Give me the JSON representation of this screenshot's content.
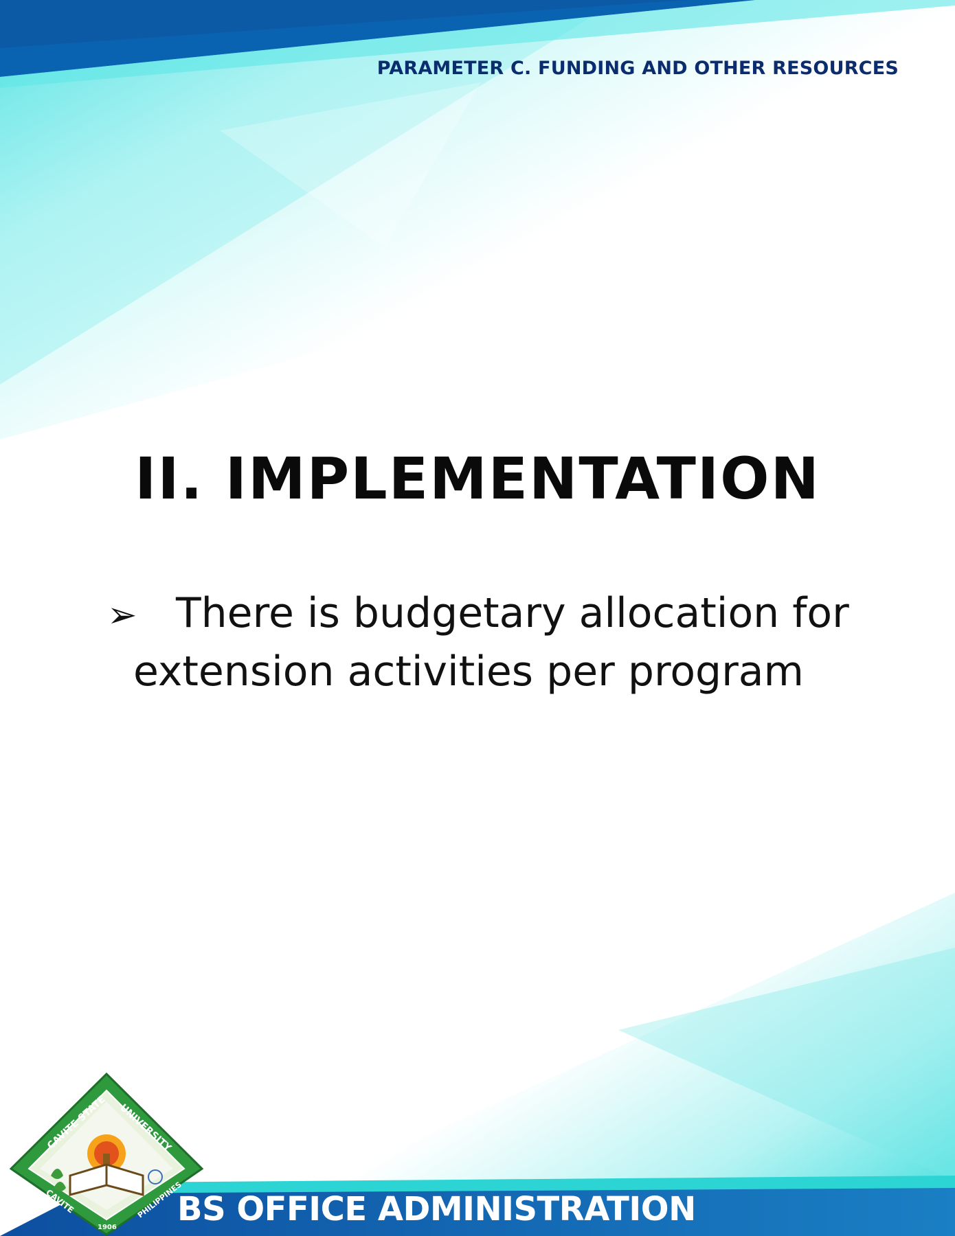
{
  "header": {
    "parameter_title": "PARAMETER C. FUNDING AND OTHER RESOURCES"
  },
  "main": {
    "section_title": "II. IMPLEMENTATION",
    "bullet": {
      "icon": "arrow-bullet-icon",
      "line1": "There is budgetary allocation for",
      "line2": "extension activities per program"
    }
  },
  "footer": {
    "program_name": "BS OFFICE ADMINISTRATION",
    "logo": {
      "name": "cavite-state-university-seal",
      "text_top": "CAVITE STATE UNIVERSITY",
      "text_bottom_left": "CAVITE",
      "text_bottom_right": "PHILIPPINES",
      "year": "1906"
    }
  },
  "colors": {
    "header_band": "#0a63b0",
    "accent_cyan": "#5fe6e6",
    "heading_text": "#0b2c6e",
    "footer_band": "#0b56a8",
    "logo_green": "#2e9a3d"
  }
}
